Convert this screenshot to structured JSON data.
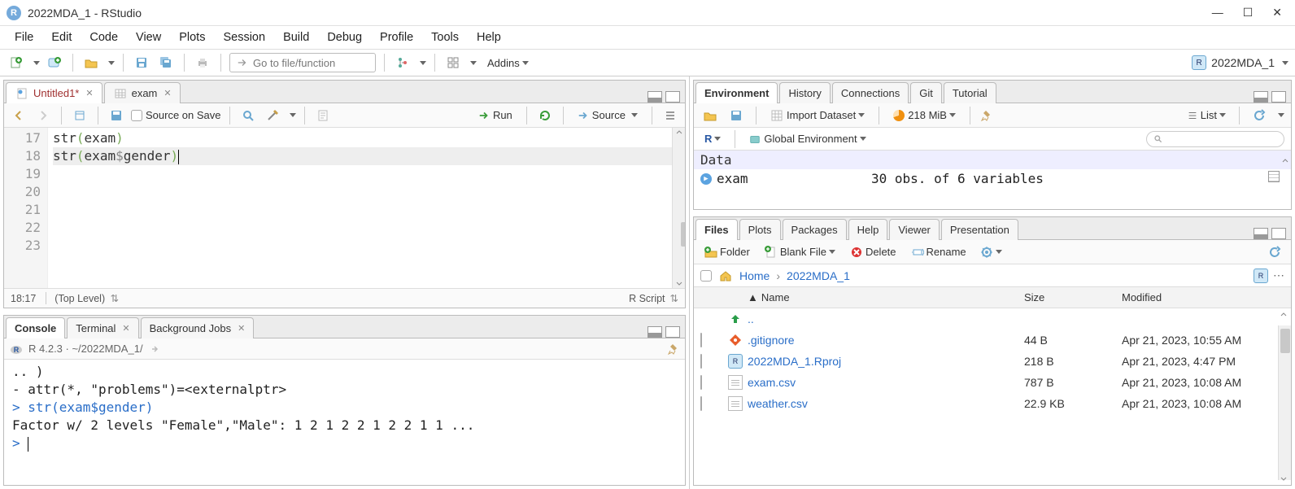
{
  "window": {
    "title": "2022MDA_1 - RStudio"
  },
  "menu": {
    "items": [
      "File",
      "Edit",
      "Code",
      "View",
      "Plots",
      "Session",
      "Build",
      "Debug",
      "Profile",
      "Tools",
      "Help"
    ]
  },
  "toolbar": {
    "goto_placeholder": "Go to file/function",
    "addins_label": "Addins",
    "project_name": "2022MDA_1"
  },
  "source": {
    "tabs": [
      {
        "label": "Untitled1*",
        "icon": "rscript",
        "unsaved": true,
        "active": true
      },
      {
        "label": "exam",
        "icon": "table",
        "unsaved": false,
        "active": false
      }
    ],
    "source_on_save": "Source on Save",
    "run_label": "Run",
    "source_label": "Source",
    "gutter_start": 17,
    "lines": [
      "str(exam)",
      "str(exam$gender)",
      "",
      "",
      "",
      "",
      ""
    ],
    "highlight_line_index": 1,
    "status_pos": "18:17",
    "status_scope": "(Top Level)",
    "status_lang": "R Script"
  },
  "console": {
    "tabs": [
      "Console",
      "Terminal",
      "Background Jobs"
    ],
    "active_tab": 0,
    "header": "R 4.2.3 · ~/2022MDA_1/",
    "lines": [
      {
        "type": "out",
        "text": "  .. )"
      },
      {
        "type": "out",
        "text": " - attr(*, \"problems\")=<externalptr>"
      },
      {
        "type": "cmd",
        "text": "str(exam$gender)"
      },
      {
        "type": "out",
        "text": " Factor w/ 2 levels \"Female\",\"Male\": 1 2 1 2 2 1 2 2 1 1 ..."
      },
      {
        "type": "prompt",
        "text": ""
      }
    ]
  },
  "env": {
    "tabs": [
      "Environment",
      "History",
      "Connections",
      "Git",
      "Tutorial"
    ],
    "active_tab": 0,
    "import_label": "Import Dataset",
    "mem_label": "218 MiB",
    "view_label": "List",
    "scope_badge": "R",
    "scope_label": "Global Environment",
    "section_label": "Data",
    "rows": [
      {
        "name": "exam",
        "value": "30 obs. of 6 variables"
      }
    ]
  },
  "files": {
    "tabs": [
      "Files",
      "Plots",
      "Packages",
      "Help",
      "Viewer",
      "Presentation"
    ],
    "active_tab": 0,
    "tool": {
      "folder": "Folder",
      "blank": "Blank File",
      "delete": "Delete",
      "rename": "Rename"
    },
    "breadcrumb": {
      "home": "Home",
      "path": "2022MDA_1"
    },
    "columns": {
      "name": "Name",
      "size": "Size",
      "modified": "Modified"
    },
    "up_label": "..",
    "rows": [
      {
        "icon": "git",
        "name": ".gitignore",
        "size": "44 B",
        "modified": "Apr 21, 2023, 10:55 AM"
      },
      {
        "icon": "rproj",
        "name": "2022MDA_1.Rproj",
        "size": "218 B",
        "modified": "Apr 21, 2023, 4:47 PM"
      },
      {
        "icon": "csv",
        "name": "exam.csv",
        "size": "787 B",
        "modified": "Apr 21, 2023, 10:08 AM"
      },
      {
        "icon": "csv",
        "name": "weather.csv",
        "size": "22.9 KB",
        "modified": "Apr 21, 2023, 10:08 AM"
      }
    ]
  }
}
